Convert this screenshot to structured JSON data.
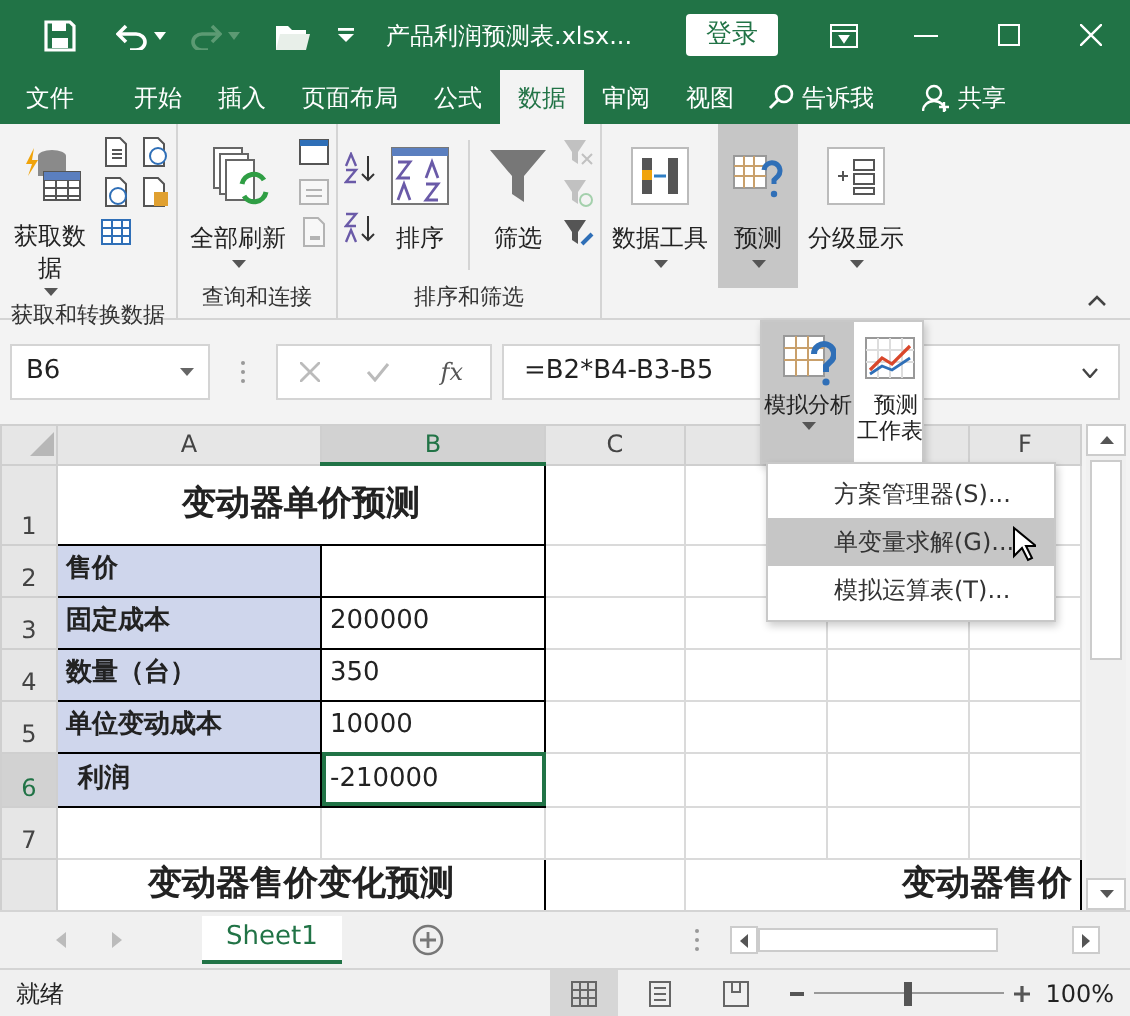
{
  "window": {
    "title": "产品利润预测表.xlsx...",
    "login": "登录"
  },
  "tabs": [
    {
      "label": "文件",
      "selected": false
    },
    {
      "label": "开始",
      "selected": false
    },
    {
      "label": "插入",
      "selected": false
    },
    {
      "label": "页面布局",
      "selected": false
    },
    {
      "label": "公式",
      "selected": false
    },
    {
      "label": "数据",
      "selected": true
    },
    {
      "label": "审阅",
      "selected": false
    },
    {
      "label": "视图",
      "selected": false
    }
  ],
  "tell_me": "告诉我",
  "share": "共享",
  "ribbon": {
    "groups": [
      {
        "label": "获取和转换数据",
        "buttons": [
          {
            "label": "获取数据",
            "selected": false
          }
        ]
      },
      {
        "label": "查询和连接",
        "buttons": [
          {
            "label": "全部刷新",
            "selected": false
          }
        ]
      },
      {
        "label": "排序和筛选",
        "buttons": [
          {
            "label": "排序",
            "selected": false
          },
          {
            "label": "筛选",
            "selected": false
          }
        ]
      },
      {
        "buttons": [
          {
            "label": "数据工具",
            "selected": false
          }
        ]
      },
      {
        "buttons": [
          {
            "label": "预测",
            "selected": true
          }
        ]
      },
      {
        "buttons": [
          {
            "label": "分级显示",
            "selected": false
          }
        ]
      }
    ]
  },
  "formula_bar": {
    "name_box": "B6",
    "insert_function": "fx",
    "formula": "=B2*B4-B3-B5"
  },
  "forecast_panel": {
    "buttons": [
      {
        "label": "模拟分析",
        "selected": true
      },
      {
        "label": "预测工作表",
        "selected": false
      }
    ],
    "menu": [
      {
        "label": "方案管理器(S)...",
        "selected": false
      },
      {
        "label": "单变量求解(G)...",
        "selected": true
      },
      {
        "label": "模拟运算表(T)...",
        "selected": false
      }
    ]
  },
  "sheet": {
    "columns": [
      {
        "label": "A",
        "selected": false
      },
      {
        "label": "B",
        "selected": true
      },
      {
        "label": "C",
        "selected": false
      },
      {
        "selected": false
      },
      {
        "selected": false
      },
      {
        "label": "F",
        "selected": false
      }
    ],
    "rows": [
      {
        "number": "1",
        "selected": false,
        "cells": [
          {
            "kind": "title",
            "text": "变动器单价预测",
            "colspan": 2
          }
        ]
      },
      {
        "number": "2",
        "selected": false,
        "cells": [
          {
            "kind": "label",
            "text": "售价"
          },
          {
            "kind": "value",
            "active": false
          }
        ]
      },
      {
        "number": "3",
        "selected": false,
        "cells": [
          {
            "kind": "label",
            "text": "固定成本"
          },
          {
            "kind": "value",
            "text": "200000",
            "active": false
          }
        ]
      },
      {
        "number": "4",
        "selected": false,
        "cells": [
          {
            "kind": "label",
            "text": "数量（台）"
          },
          {
            "kind": "value",
            "text": "350",
            "active": false
          }
        ]
      },
      {
        "number": "5",
        "selected": false,
        "cells": [
          {
            "kind": "label",
            "text": "单位变动成本"
          },
          {
            "kind": "value",
            "text": "10000",
            "active": false
          }
        ]
      },
      {
        "number": "6",
        "selected": true,
        "cells": [
          {
            "kind": "label",
            "text": "利润"
          },
          {
            "kind": "value",
            "text": "-210000",
            "active": true
          }
        ]
      },
      {
        "number": "7",
        "selected": false,
        "cells": []
      },
      {
        "selected": false,
        "cells": [
          {
            "kind": "title",
            "text": "变动器售价变化预测",
            "colspan": 2
          },
          {
            "kind": "blank"
          },
          {
            "kind": "wide_title",
            "text": "变动器售价",
            "colspan": 3
          }
        ]
      }
    ]
  },
  "sheet_tabs": [
    {
      "label": "Sheet1",
      "selected": true
    }
  ],
  "status_bar": {
    "status": "就绪",
    "views": [
      {
        "selected": true
      },
      {
        "selected": false
      },
      {
        "selected": false
      }
    ],
    "zoom": {
      "level": 0.5,
      "reading": "100%"
    }
  }
}
